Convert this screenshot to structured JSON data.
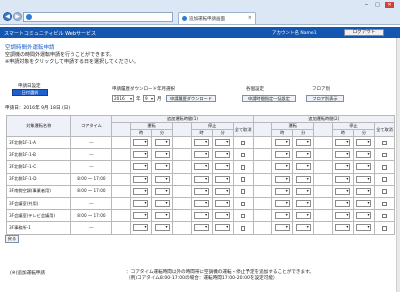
{
  "browser": {
    "address_text": "",
    "tab_title": "追加運転申請画面",
    "back_glyph": "◀",
    "forward_glyph": "▶",
    "minimize": "─",
    "maximize": "□",
    "close": "✕",
    "tab_close": "×"
  },
  "site": {
    "title": "スマートコミュニティビル Webサービス",
    "user": "アカウント名 Name1",
    "logout_label": "ログアウト"
  },
  "page": {
    "title": "空調時間外運転申請",
    "intro_line1": "空調機の時間外運転申請を行うことができます。",
    "intro_line2": "※申請対象をクリックして申請する日を選択してください。"
  },
  "controls": {
    "apply_setting_label": "申請日設定",
    "apply_setting_button": "日付選択",
    "monthly_label": "申請履歴ダウンロード年月選択",
    "year_value": "2016",
    "year_unit": "年",
    "month_value": "9",
    "month_unit": "月",
    "download_button": "申請履歴ダウンロード",
    "individual_label": "各個設定",
    "individual_button": "申請時間指定一括設定",
    "floor_label": "フロア別",
    "floor_button": "フロア別表示",
    "apply_date": "申請日：2016年 9月 18日 (日)"
  },
  "table": {
    "h_target": "対象運転名称",
    "h_core": "コアタイム",
    "h_extra1": "追加運転時間(1)",
    "h_extra2": "追加運転時間(2)",
    "h_start": "運転",
    "h_stop": "停止",
    "h_cancel": "全て取消",
    "h_hour": "時",
    "h_minute": "分",
    "rows": [
      {
        "name": "3F北側1F-1-A",
        "core": "―"
      },
      {
        "name": "3F北側1F-1-B",
        "core": "―"
      },
      {
        "name": "3F北側1F-1-C",
        "core": "―"
      },
      {
        "name": "3F北側1F-1-D",
        "core": "8:00 ～ 17:00"
      },
      {
        "name": "3F南側空調(事業者用)",
        "core": "8:00 ～ 17:00"
      },
      {
        "name": "3F会議室(共用)",
        "core": "―"
      },
      {
        "name": "3F会議室(テレビ会議用)",
        "core": "8:00 ～ 17:00"
      },
      {
        "name": "3F事務所-1",
        "core": "―"
      }
    ]
  },
  "bottom": {
    "back_button": "戻る",
    "note_left": "(※)追加運転申請",
    "note_right_1": "：コアタイム運転時間以外の時間帯に空調機の運転・停止予定を追加することができます。",
    "note_right_2": "（例)コアタイム8:00-17:00の場合：運転時間17:00-20:00を設定可能）"
  },
  "colors": {
    "site_bar": "#1557b0",
    "accent_title": "#1a5cc8",
    "button_blue": "#1f5fd0"
  }
}
